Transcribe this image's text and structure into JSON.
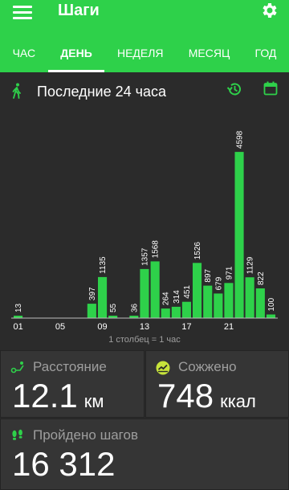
{
  "app": {
    "title": "Шаги"
  },
  "tabs": [
    "ЧАС",
    "ДЕНЬ",
    "НЕДЕЛЯ",
    "МЕСЯЦ",
    "ГОД"
  ],
  "active_tab": 1,
  "period": {
    "label": "Последние 24 часа"
  },
  "chart_data": {
    "type": "bar",
    "x_tick_labels": [
      "01",
      "05",
      "09",
      "13",
      "17",
      "21"
    ],
    "values": [
      13,
      0,
      0,
      0,
      0,
      0,
      0,
      397,
      1135,
      55,
      0,
      36,
      1357,
      1568,
      264,
      314,
      451,
      1526,
      897,
      679,
      971,
      4598,
      1129,
      822,
      100
    ],
    "value_labels": [
      "13",
      "",
      "",
      "",
      "",
      "",
      "",
      "397",
      "1135",
      "55",
      "",
      "36",
      "1357",
      "1568",
      "264",
      "314",
      "451",
      "1526",
      "897",
      "679",
      "971",
      "4598",
      "1129",
      "822",
      "100"
    ],
    "footnote": "1 столбец = 1 час",
    "bar_color": "#2ed14a",
    "ylim": [
      0,
      4800
    ]
  },
  "stats": {
    "distance": {
      "label": "Расстояние",
      "value": "12.1",
      "unit": "км"
    },
    "burned": {
      "label": "Сожжено",
      "value": "748",
      "unit": "ккал"
    },
    "steps": {
      "label": "Пройдено шагов",
      "value": "16 312"
    }
  },
  "colors": {
    "accent": "#2ed14a",
    "background": "#2b2b2b",
    "card": "#353535"
  },
  "icons": [
    "menu-icon",
    "gear-icon",
    "walk-icon",
    "history-icon",
    "calendar-icon",
    "footprints-icon",
    "flame-icon",
    "steps-icon"
  ]
}
